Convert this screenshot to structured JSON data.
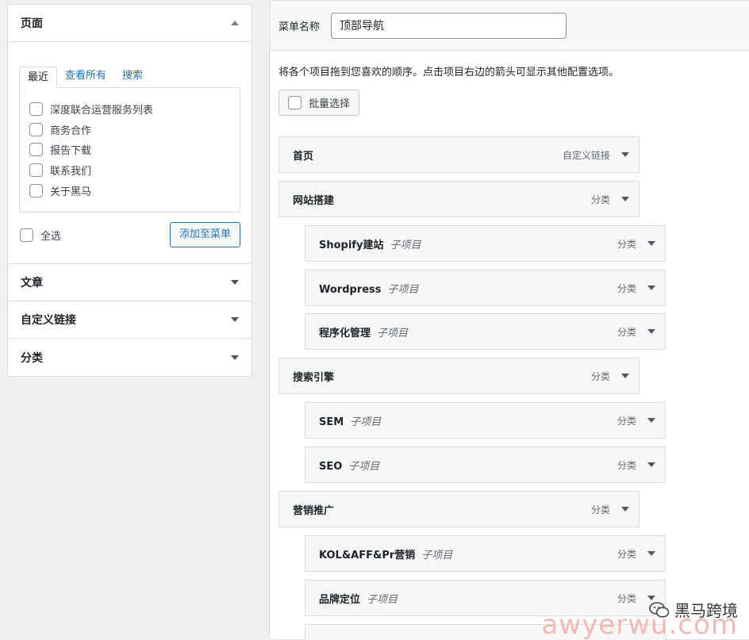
{
  "left_panel": {
    "pages_section": {
      "title": "页面",
      "tabs": [
        "最近",
        "查看所有",
        "搜索"
      ],
      "items": [
        "深度联合运营服务列表",
        "商务合作",
        "报告下载",
        "联系我们",
        "关于黑马"
      ],
      "select_all_label": "全选",
      "add_button_label": "添加至菜单"
    },
    "collapsed_sections": [
      "文章",
      "自定义链接",
      "分类"
    ]
  },
  "right_panel": {
    "menu_name_label": "菜单名称",
    "menu_name_value": "顶部导航",
    "instructions": "将各个项目拖到您喜欢的顺序。点击项目右边的箭头可显示其他配置选项。",
    "bulk_select_label": "批量选择",
    "sub_item_label": "子项目",
    "menu_items": [
      {
        "title": "首页",
        "type": "自定义链接",
        "level": 0
      },
      {
        "title": "网站搭建",
        "type": "分类",
        "level": 0
      },
      {
        "title": "Shopify建站",
        "type": "分类",
        "level": 1
      },
      {
        "title": "Wordpress",
        "type": "分类",
        "level": 1
      },
      {
        "title": "程序化管理",
        "type": "分类",
        "level": 1
      },
      {
        "title": "搜索引擎",
        "type": "分类",
        "level": 0
      },
      {
        "title": "SEM",
        "type": "分类",
        "level": 1
      },
      {
        "title": "SEO",
        "type": "分类",
        "level": 1
      },
      {
        "title": "营销推广",
        "type": "分类",
        "level": 0
      },
      {
        "title": "KOL&AFF&Pr营销",
        "type": "分类",
        "level": 1
      },
      {
        "title": "品牌定位",
        "type": "分类",
        "level": 1
      }
    ]
  },
  "watermark": {
    "brand": "黑马跨境",
    "domain": "awyerwu.com"
  }
}
